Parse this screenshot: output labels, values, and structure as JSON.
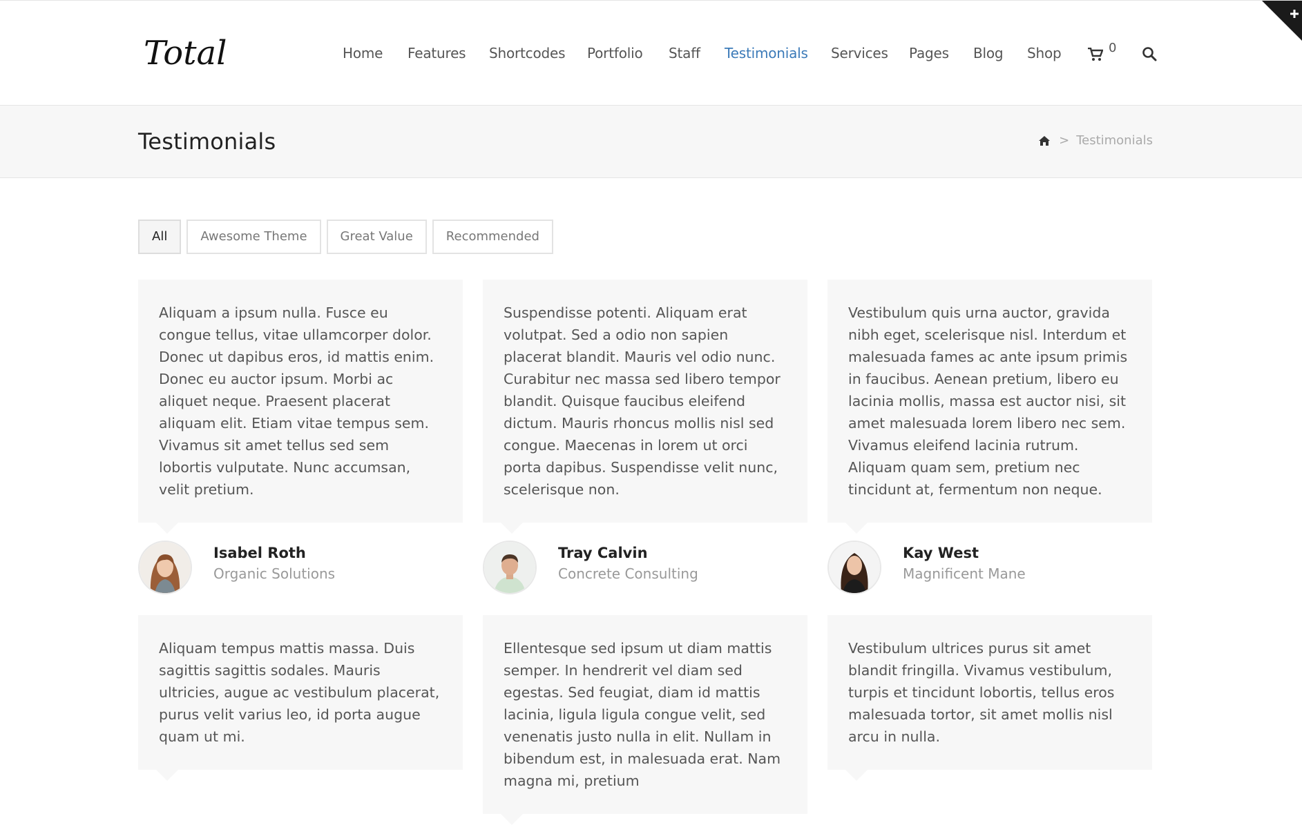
{
  "site": {
    "logo_text": "Total"
  },
  "nav": {
    "items": [
      {
        "label": "Home"
      },
      {
        "label": "Features"
      },
      {
        "label": "Shortcodes"
      },
      {
        "label": "Portfolio"
      },
      {
        "label": "Staff"
      },
      {
        "label": "Testimonials"
      },
      {
        "label": "Services"
      },
      {
        "label": "Pages"
      },
      {
        "label": "Blog"
      },
      {
        "label": "Shop"
      }
    ],
    "active": "Testimonials",
    "cart_count": "0",
    "cart_icon": "cart-icon",
    "search_icon": "search-icon"
  },
  "page": {
    "title": "Testimonials",
    "breadcrumb": {
      "home_icon": "home-icon",
      "separator": ">",
      "current": "Testimonials"
    }
  },
  "filters": [
    {
      "label": "All",
      "active": true
    },
    {
      "label": "Awesome Theme",
      "active": false
    },
    {
      "label": "Great Value",
      "active": false
    },
    {
      "label": "Recommended",
      "active": false
    }
  ],
  "testimonials": [
    {
      "text": "Aliquam a ipsum nulla. Fusce eu congue tellus, vitae ullamcorper dolor. Donec ut dapibus eros, id mattis enim. Donec eu auctor ipsum. Morbi ac aliquet neque. Praesent placerat aliquam elit. Etiam vitae tempus sem. Vivamus sit amet tellus sed sem lobortis vulputate. Nunc accumsan, velit pretium.",
      "name": "Isabel Roth",
      "company": "Organic Solutions"
    },
    {
      "text": "Suspendisse potenti. Aliquam erat volutpat. Sed a odio non sapien placerat blandit. Mauris vel odio nunc. Curabitur nec massa sed libero tempor blandit. Quisque faucibus eleifend dictum. Mauris rhoncus mollis nisl sed congue. Maecenas in lorem ut orci porta dapibus. Suspendisse velit nunc, scelerisque non.",
      "name": "Tray Calvin",
      "company": "Concrete Consulting"
    },
    {
      "text": "Vestibulum quis urna auctor, gravida nibh eget, scelerisque nisl. Interdum et malesuada fames ac ante ipsum primis in faucibus. Aenean pretium, libero eu lacinia mollis, massa est auctor nisi, sit amet malesuada lorem libero nec sem. Vivamus eleifend lacinia rutrum. Aliquam quam sem, pretium nec tincidunt at, fermentum non neque.",
      "name": "Kay West",
      "company": "Magnificent Mane"
    },
    {
      "text": "Aliquam tempus mattis massa. Duis sagittis sagittis sodales. Mauris ultricies, augue ac vestibulum placerat, purus velit varius leo, id porta augue quam ut mi."
    },
    {
      "text": "Ellentesque sed ipsum ut diam mattis semper. In hendrerit vel diam sed egestas. Sed feugiat, diam id mattis lacinia, ligula ligula congue velit, sed venenatis justo nulla in elit. Nullam in bibendum est, in malesuada erat. Nam magna mi, pretium"
    },
    {
      "text": "Vestibulum ultrices purus sit amet blandit fringilla. Vivamus vestibulum, turpis et tincidunt lobortis, tellus eros malesuada tortor, sit amet mollis nisl arcu in nulla."
    }
  ],
  "colors": {
    "accent": "#3b7ab8",
    "card_bg": "#f7f7f7",
    "title_bar_bg": "#f7f7f7",
    "corner": "#1a1a1a"
  }
}
